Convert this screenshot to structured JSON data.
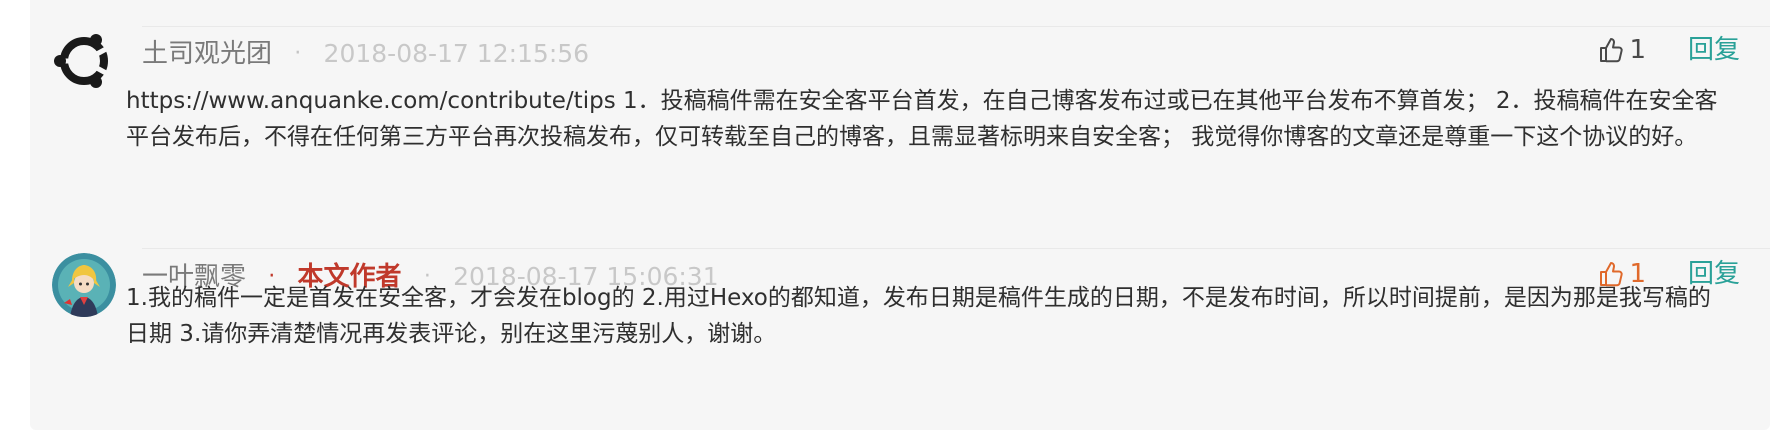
{
  "comments": [
    {
      "user": "土司观光团",
      "separator": "·",
      "time": "2018-08-17 12:15:56",
      "likes": "1",
      "reply_label": "回复",
      "like_icon": "thumbs-up-outline-icon",
      "avatar": "ubuntu-logo-avatar",
      "text": "https://www.anquanke.com/contribute/tips 1．投稿稿件需在安全客平台首发，在自己博客发布过或已在其他平台发布不算首发； 2．投稿稿件在安全客平台发布后，不得在任何第三方平台再次投稿发布，仅可转载至自己的博客，且需显著标明来自安全客； 我觉得你博客的文章还是尊重一下这个协议的好。"
    },
    {
      "user": "一叶飘零",
      "separator": "·",
      "author_badge": "本文作者",
      "time": "2018-08-17 15:06:31",
      "likes": "1",
      "reply_label": "回复",
      "like_icon": "thumbs-up-orange-icon",
      "avatar": "anime-character-avatar",
      "text": "1.我的稿件一定是首发在安全客，才会发在blog的 2.用过Hexo的都知道，发布日期是稿件生成的日期，不是发布时间，所以时间提前，是因为那是我写稿的日期 3.请你弄清楚情况再发表评论，别在这里污蔑别人，谢谢。"
    }
  ],
  "colors": {
    "author_badge": "#c0392b",
    "reply": "#2aa198",
    "liked": "#e0692b"
  }
}
